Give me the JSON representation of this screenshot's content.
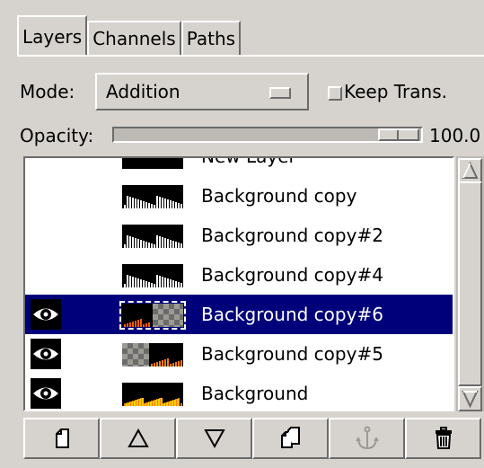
{
  "tabs": [
    {
      "label": "Layers",
      "active": true
    },
    {
      "label": "Channels",
      "active": false
    },
    {
      "label": "Paths",
      "active": false
    }
  ],
  "mode": {
    "label": "Mode:",
    "value": "Addition"
  },
  "keep_trans": {
    "label": "Keep Trans.",
    "checked": false
  },
  "opacity": {
    "label": "Opacity:",
    "value": "100.0",
    "fraction": 1.0
  },
  "layers": [
    {
      "name": "New Layer",
      "visible": false,
      "selected": false,
      "thumb": "partial"
    },
    {
      "name": "Background copy",
      "visible": false,
      "selected": false,
      "thumb": "white-flames"
    },
    {
      "name": "Background copy#2",
      "visible": false,
      "selected": false,
      "thumb": "white-flames"
    },
    {
      "name": "Background copy#4",
      "visible": false,
      "selected": false,
      "thumb": "white-flames"
    },
    {
      "name": "Background copy#6",
      "visible": true,
      "selected": true,
      "thumb": "fire-left-checker"
    },
    {
      "name": "Background copy#5",
      "visible": true,
      "selected": false,
      "thumb": "checker-left-fire"
    },
    {
      "name": "Background",
      "visible": true,
      "selected": false,
      "thumb": "fire"
    }
  ],
  "buttons": [
    {
      "name": "new-layer",
      "icon": "new-page-icon"
    },
    {
      "name": "raise-layer",
      "icon": "triangle-up-icon"
    },
    {
      "name": "lower-layer",
      "icon": "triangle-down-icon"
    },
    {
      "name": "duplicate-layer",
      "icon": "duplicate-icon"
    },
    {
      "name": "anchor-layer",
      "icon": "anchor-icon",
      "disabled": true
    },
    {
      "name": "delete-layer",
      "icon": "trash-icon"
    }
  ]
}
